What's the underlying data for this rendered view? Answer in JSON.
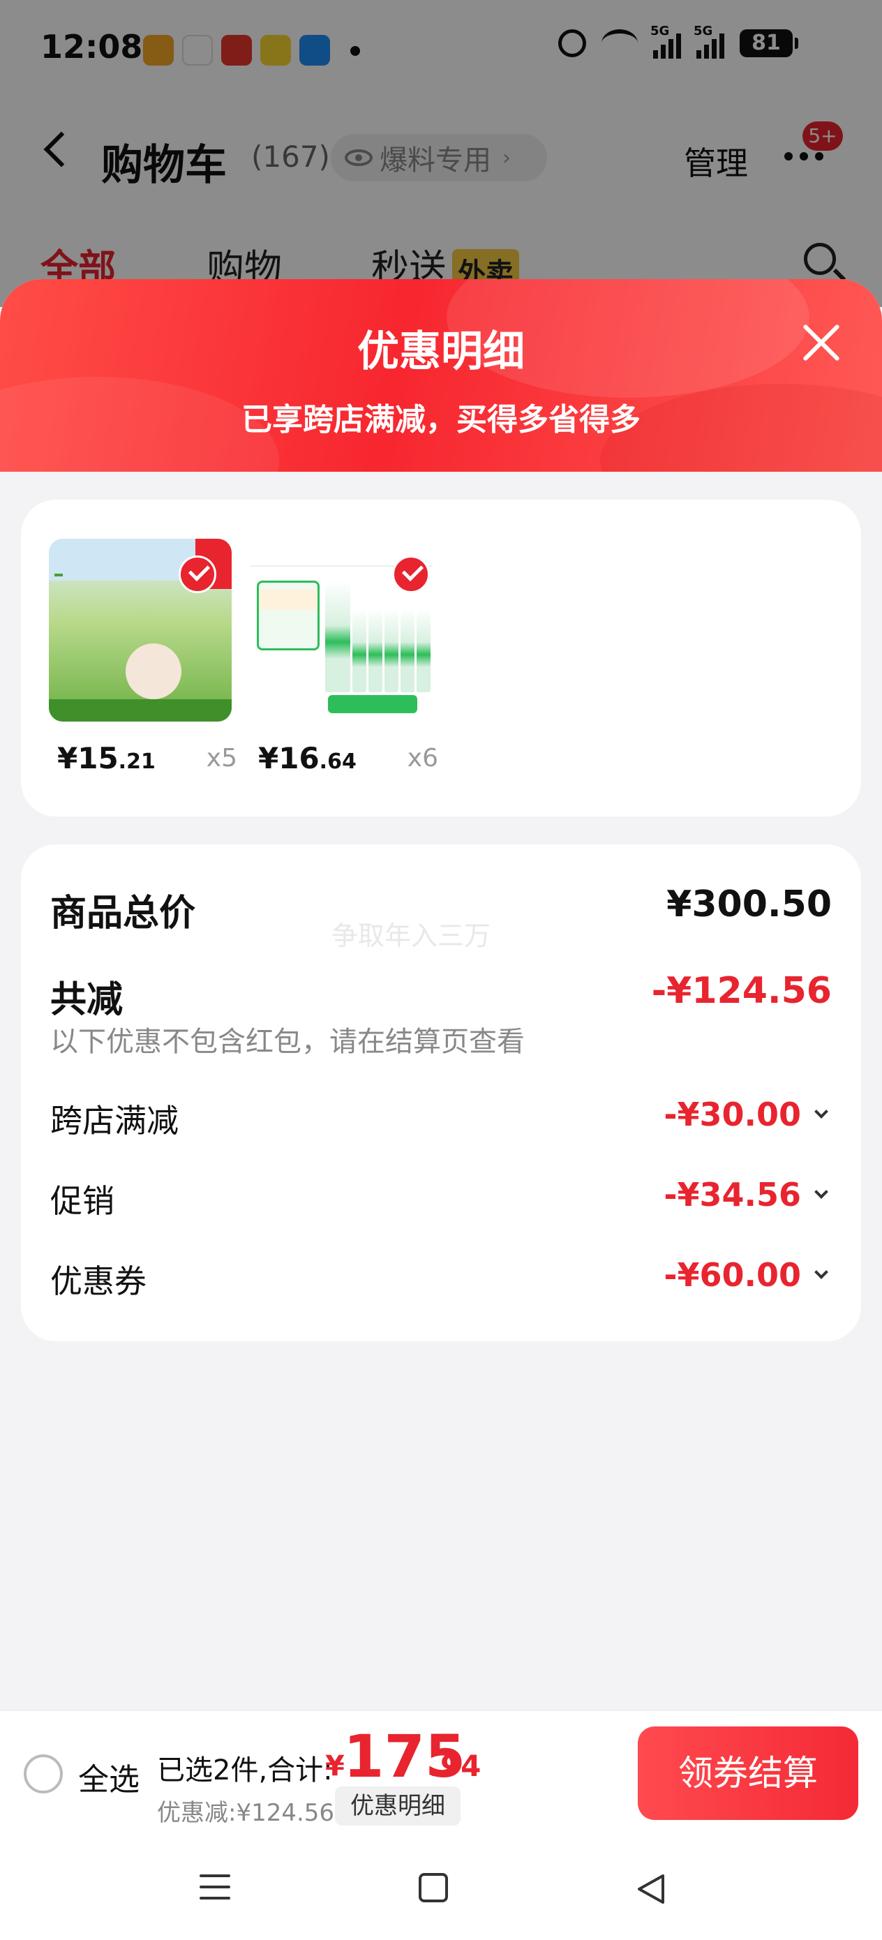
{
  "status_bar": {
    "time": "12:08",
    "battery": "81",
    "signal_label_1": "5G",
    "signal_label_2": "5G"
  },
  "background_page": {
    "title": "购物车",
    "count": "(167)",
    "hint_pill": "爆料专用",
    "manage": "管理",
    "more_badge": "5+",
    "tabs": [
      "全部",
      "购物",
      "秒送"
    ],
    "tab_tag": "外卖"
  },
  "sheet": {
    "title": "优惠明细",
    "subtitle": "已享跨店满减，买得多省得多",
    "products": [
      {
        "price_int": "¥15",
        "price_dec": ".21",
        "qty": "x5"
      },
      {
        "price_int": "¥16",
        "price_dec": ".64",
        "qty": "x6"
      }
    ],
    "summary": {
      "total_label": "商品总价",
      "total_value": "¥300.50",
      "watermark": "争取年入三万",
      "reduce_label": "共减",
      "reduce_value": "-¥124.56",
      "note": "以下优惠不包含红包，请在结算页查看",
      "items": [
        {
          "label": "跨店满减",
          "value": "-¥30.00"
        },
        {
          "label": "促销",
          "value": "-¥34.56"
        },
        {
          "label": "优惠券",
          "value": "-¥60.00"
        }
      ]
    }
  },
  "bottom_bar": {
    "select_all": "全选",
    "selected_info": "已选2件,合计:",
    "total_symbol": "¥",
    "total_int": "175",
    "total_dec": ".94",
    "discount_info": "优惠减:¥124.56",
    "detail_chip": "优惠明细",
    "checkout": "领券结算"
  },
  "colors": {
    "accent": "#e8242f",
    "sheet_header": "#f7262f",
    "tag_yellow": "#f5c842"
  }
}
